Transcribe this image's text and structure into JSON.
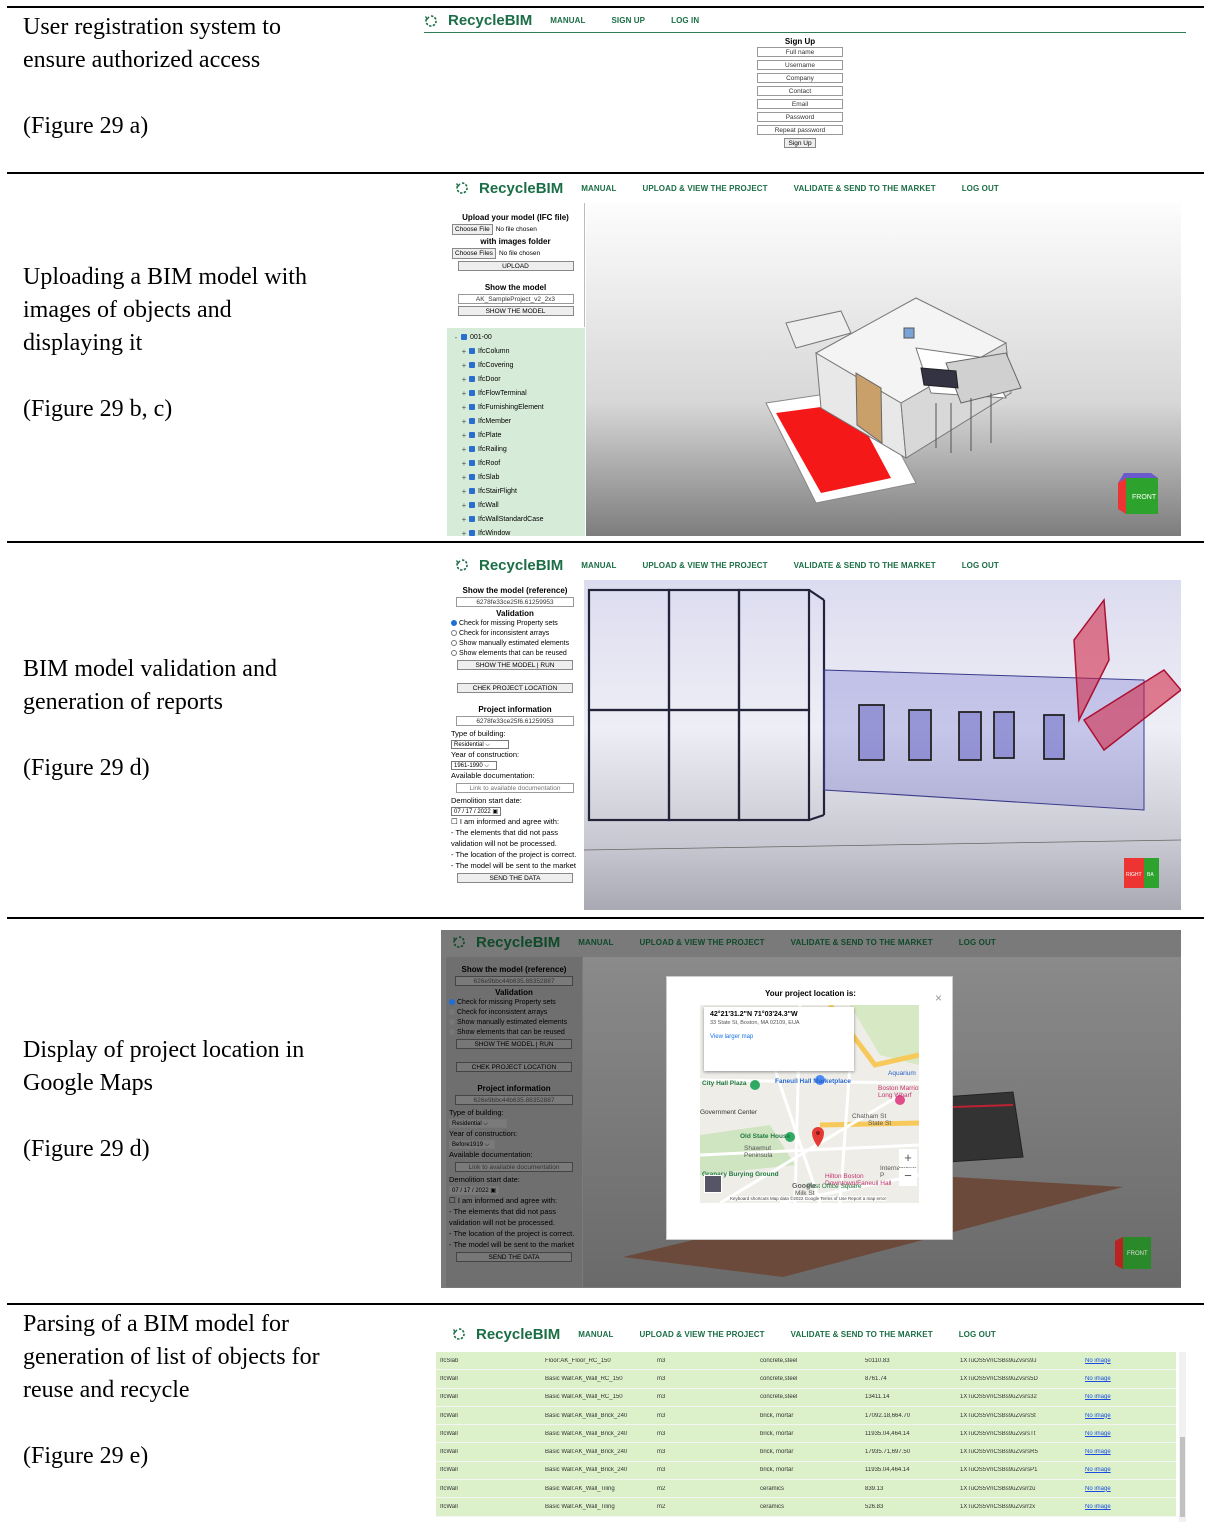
{
  "rows": [
    {
      "caption": [
        "User registration system to",
        "ensure authorized access"
      ],
      "figure": "(Figure 29 a)",
      "nav": [
        "MANUAL",
        "SIGN UP",
        "LOG IN"
      ],
      "form_title": "Sign Up",
      "fields": [
        "Full name",
        "Username",
        "Company",
        "Contact",
        "Email",
        "Password",
        "Repeat password"
      ],
      "button": "Sign Up"
    },
    {
      "caption": [
        "Uploading a BIM model with",
        "images of objects and",
        "displaying it"
      ],
      "figure": "(Figure 29 b, c)",
      "nav": [
        "MANUAL",
        "UPLOAD & VIEW THE PROJECT",
        "VALIDATE & SEND TO THE MARKET",
        "LOG OUT"
      ],
      "upload_title": "Upload your model (IFC file)",
      "choose_file": "Choose File",
      "no_file": "No file chosen",
      "images_title": "with images folder",
      "choose_files": "Choose Files",
      "upload_btn": "UPLOAD",
      "show_title": "Show the model",
      "model_name": "AK_SampleProject_v2_2x3",
      "show_btn": "SHOW THE MODEL",
      "tree_root": "001-00",
      "tree_items": [
        "IfcColumn",
        "IfcCovering",
        "IfcDoor",
        "IfcFlowTerminal",
        "IfcFurnishingElement",
        "IfcMember",
        "IfcPlate",
        "IfcRailing",
        "IfcRoof",
        "IfcSlab",
        "IfcStairFlight",
        "IfcWall",
        "IfcWallStandardCase",
        "IfcWindow"
      ],
      "cube": "FRONT"
    },
    {
      "caption": [
        "BIM model validation and",
        "generation of reports"
      ],
      "figure": "(Figure 29 d)",
      "nav": [
        "MANUAL",
        "UPLOAD & VIEW THE PROJECT",
        "VALIDATE & SEND TO THE MARKET",
        "LOG OUT"
      ],
      "show_ref": "Show the model (reference)",
      "ref": "6278fe33ce25f6.61259953",
      "validation": "Validation",
      "options": [
        "Check for missing Property sets",
        "Check for inconsistent arrays",
        "Show manually estimated elements",
        "Show elements that can be reused"
      ],
      "run_btn": "SHOW THE MODEL | RUN",
      "loc_btn": "CHEK PROJECT LOCATION",
      "info_title": "Project information",
      "type_lbl": "Type of building:",
      "type_val": "Residential",
      "year_lbl": "Year of construction:",
      "year_val": "1961-1990",
      "doc_lbl": "Available documentation:",
      "doc_ph": "Link to available documentation",
      "demo_lbl": "Demolition start date:",
      "date": "07 / 17 / 2022",
      "agree": "I am informed and agree with:",
      "notes": [
        "- The elements that did not pass",
        "validation will not be processed.",
        "- The location of the project is correct.",
        "- The model will be sent to the market"
      ],
      "send_btn": "SEND THE DATA",
      "cube_l": "RIGHT",
      "cube_r": "BA"
    },
    {
      "caption": [
        "Display of project location in",
        "Google Maps"
      ],
      "figure": "(Figure 29 d)",
      "nav": [
        "MANUAL",
        "UPLOAD & VIEW THE PROJECT",
        "VALIDATE & SEND TO THE MARKET",
        "LOG OUT"
      ],
      "show_ref": "Show the model (reference)",
      "ref": "626e9bbc44b635.88352887",
      "validation": "Validation",
      "options": [
        "Check for missing Property sets",
        "Check for inconsistent arrays",
        "Show manually estimated elements",
        "Show elements that can be reused"
      ],
      "run_btn": "SHOW THE MODEL | RUN",
      "loc_btn": "CHEK PROJECT LOCATION",
      "info_title": "Project information",
      "type_lbl": "Type of building:",
      "type_val": "Residential",
      "year_lbl": "Year of construction:",
      "year_val": "Before1919",
      "doc_lbl": "Available documentation:",
      "doc_ph": "Link to available documentation",
      "demo_lbl": "Demolition start date:",
      "date": "07 / 17 / 2022",
      "agree": "I am informed and agree with:",
      "notes": [
        "- The elements that did not pass",
        "validation will not be processed.",
        "- The location of the project is correct.",
        "- The model will be sent to the market"
      ],
      "send_btn": "SEND THE DATA",
      "modal_title": "Your project location is:",
      "coords": "42°21'31.2\"N 71°03'24.3\"W",
      "address": "33 State St, Boston, MA 02109, EUA",
      "larger_map": "View larger map",
      "map_labels": [
        "City Hall Plaza",
        "Faneuil Hall Marketplace",
        "Boston Marriott Long Wharf",
        "Aquarium",
        "Old State House",
        "Shawmut Peninsula",
        "Granary Burying Ground",
        "Hilton Boston Downtown/Faneuil Hall",
        "Post Office Square",
        "Chatham St",
        "State St",
        "North St",
        "Kilby St",
        "International P",
        "Milk St",
        "Hawley St",
        "Devonshire St",
        "Broad St",
        "Congress St",
        "Pearl St",
        "Government Center",
        "Chr Co Wa"
      ],
      "map_footer": "Keyboard shortcuts   Map data ©2022 Google   Terms of Use   Report a map error",
      "google": "Google",
      "cube": "FRONT"
    },
    {
      "caption": [
        "Parsing of a BIM model for",
        "generation of list of objects for",
        "reuse and recycle"
      ],
      "figure": "(Figure 29 e)",
      "nav": [
        "MANUAL",
        "UPLOAD & VIEW THE PROJECT",
        "VALIDATE & SEND TO THE MARKET",
        "LOG OUT"
      ],
      "table": [
        [
          "IfcSlab",
          "Floor:AK_Floor_RC_150",
          "m3",
          "concrete,steel",
          "50110.83",
          "1XTuOS5VnCSBs9uZvsrs9J",
          "No image"
        ],
        [
          "IfcWall",
          "Basic Wall:AK_Wall_RC_150",
          "m3",
          "concrete,steel",
          "8761.74",
          "1XTuOS5VnCSBs9uZvsrs5D",
          "No image"
        ],
        [
          "IfcWall",
          "Basic Wall:AK_Wall_RC_150",
          "m3",
          "concrete,steel",
          "13411.14",
          "1XTuOS5VnCSBs9uZvsrs32",
          "No image"
        ],
        [
          "IfcWall",
          "Basic Wall:AK_Wall_Brick_240",
          "m3",
          "brick, mortar",
          "17092.18,664.70",
          "1XTuOS5VnCSBs9uZvsrsSt",
          "No image"
        ],
        [
          "IfcWall",
          "Basic Wall:AK_Wall_Brick_240",
          "m3",
          "brick, mortar",
          "11935.04,464.14",
          "1XTuOS5VnCSBs9uZvsrsTt",
          "No image"
        ],
        [
          "IfcWall",
          "Basic Wall:AK_Wall_Brick_240",
          "m3",
          "brick, mortar",
          "17935.71,697.50",
          "1XTuOS5VnCSBs9uZvsrsR5",
          "No image"
        ],
        [
          "IfcWall",
          "Basic Wall:AK_Wall_Brick_240",
          "m3",
          "brick, mortar",
          "11935.04,464.14",
          "1XTuOS5VnCSBs9uZvsrsP1",
          "No image"
        ],
        [
          "IfcWall",
          "Basic Wall:AK_Wall_Tiling",
          "m2",
          "ceramics",
          "839.13",
          "1XTuOS5VnCSBs9uZvsrrzu",
          "No image"
        ],
        [
          "IfcWall",
          "Basic Wall:AK_Wall_Tiling",
          "m2",
          "ceramics",
          "526.83",
          "1XTuOS5VnCSBs9uZvsrrzx",
          "No image"
        ]
      ]
    }
  ],
  "brand": "RecycleBIM",
  "colors": {
    "brand": "#1b6e45",
    "panel": "#dbeedd",
    "table_row": "#dcf0c9",
    "link": "#1a4de0"
  }
}
